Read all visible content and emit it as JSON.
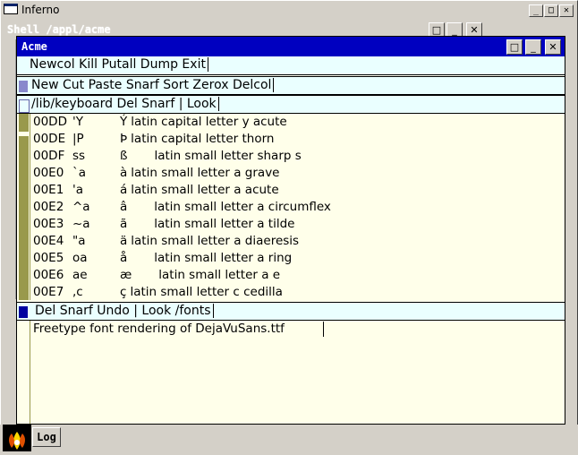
{
  "window": {
    "title": "Inferno"
  },
  "shell": {
    "title": "Shell /appl/acme"
  },
  "acme": {
    "title": "Acme",
    "main_tag": "Newcol Kill Putall Dump Exit",
    "col_tag": "New Cut Paste Snarf Sort Zerox Delcol",
    "win1_tag": "/lib/keyboard Del Snarf | Look",
    "win1_lines": [
      {
        "code": "00DD",
        "key": "'Y",
        "glyph": "Ý",
        "desc": "latin capital letter y acute"
      },
      {
        "code": "00DE",
        "key": "|P",
        "glyph": "Þ",
        "desc": "latin capital letter thorn"
      },
      {
        "code": "00DF",
        "key": "ss",
        "glyph": "ß",
        "desc": "latin small letter sharp s"
      },
      {
        "code": "00E0",
        "key": "`a",
        "glyph": "à",
        "desc": "latin small letter a grave"
      },
      {
        "code": "00E1",
        "key": "'a",
        "glyph": "á",
        "desc": "latin small letter a acute"
      },
      {
        "code": "00E2",
        "key": "^a",
        "glyph": "â",
        "desc": "latin small letter a circumflex"
      },
      {
        "code": "00E3",
        "key": "~a",
        "glyph": "ã",
        "desc": "latin small letter a tilde"
      },
      {
        "code": "00E4",
        "key": "\"a",
        "glyph": "ä",
        "desc": "latin small letter a diaeresis"
      },
      {
        "code": "00E5",
        "key": "oa",
        "glyph": "å",
        "desc": "latin small letter a ring"
      },
      {
        "code": "00E6",
        "key": "ae",
        "glyph": "æ",
        "desc": "latin small letter a e"
      },
      {
        "code": "00E7",
        "key": ",c",
        "glyph": "ç",
        "desc": "latin small letter c cedilla"
      }
    ],
    "win2_tag": "Del Snarf Undo | Look  /fonts",
    "win2_body": "Freetype font rendering of DejaVuSans.ttf"
  },
  "taskbar": {
    "log_label": "Log"
  },
  "icons": {
    "close": "✕",
    "minimize": "_",
    "maximize": "□"
  },
  "colors": {
    "acme_title": "#0000c0",
    "tag_bg": "#eaffff",
    "body_bg": "#ffffea",
    "scrollbar": "#99994c"
  }
}
